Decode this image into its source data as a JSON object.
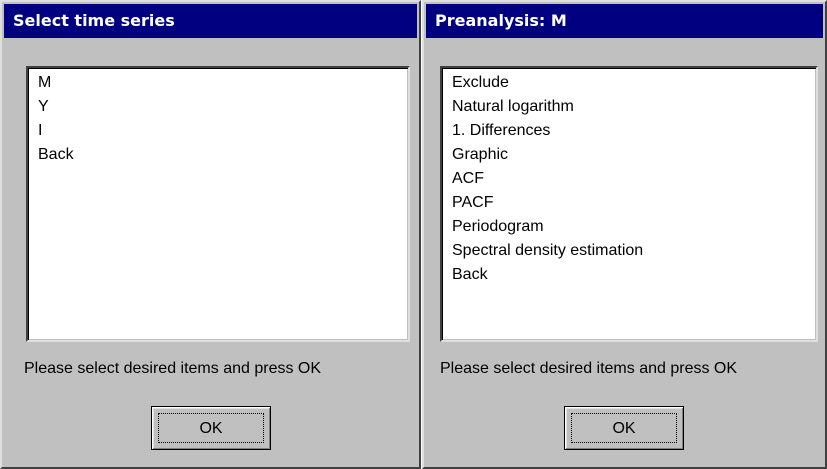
{
  "dialogs": [
    {
      "title": "Select time series",
      "items": [
        "M",
        "Y",
        "I",
        "Back"
      ],
      "status": "Please select desired items and press OK",
      "ok_label": "OK"
    },
    {
      "title": "Preanalysis: M",
      "items": [
        "Exclude",
        "Natural logarithm",
        "1. Differences",
        "Graphic",
        "ACF",
        "PACF",
        "Periodogram",
        "Spectral density estimation",
        "Back"
      ],
      "status": "Please select desired items and press OK",
      "ok_label": "OK"
    }
  ]
}
